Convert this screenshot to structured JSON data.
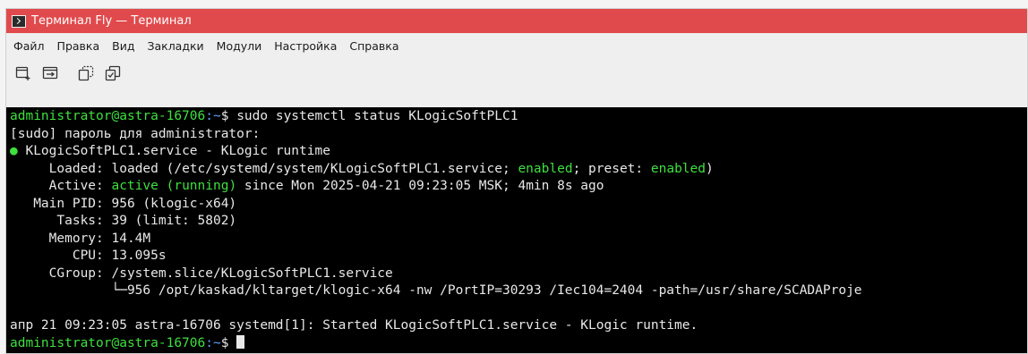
{
  "window": {
    "title": "Терминал Fly — Терминал"
  },
  "menu": [
    "Файл",
    "Правка",
    "Вид",
    "Закладки",
    "Модули",
    "Настройка",
    "Справка"
  ],
  "toolbar": {
    "icons": [
      "new-tab-icon",
      "new-window-icon",
      "copy-icon",
      "paste-icon"
    ]
  },
  "terminal": {
    "prompt_user": "administrator@astra-16706",
    "prompt_path": ":~",
    "prompt_suffix": "$ ",
    "command": "sudo systemctl status KLogicSoftPLC1",
    "sudo_line": "[sudo] пароль для administrator:",
    "unit_line": "KLogicSoftPLC1.service - KLogic runtime",
    "loaded_label": "     Loaded: ",
    "loaded_pre": "loaded (/etc/systemd/system/KLogicSoftPLC1.service; ",
    "loaded_enabled": "enabled",
    "loaded_mid": "; preset: ",
    "loaded_preset": "enabled",
    "loaded_post": ")",
    "active_label": "     Active: ",
    "active_state": "active (running)",
    "active_rest": " since Mon 2025-04-21 09:23:05 MSK; 4min 8s ago",
    "main_pid": "   Main PID: 956 (klogic-x64)",
    "tasks": "      Tasks: 39 (limit: 5802)",
    "memory": "     Memory: 14.4M",
    "cpu": "        CPU: 13.095s",
    "cgroup": "     CGroup: /system.slice/KLogicSoftPLC1.service",
    "cgroup_proc": "             └─956 /opt/kaskad/kltarget/klogic-x64 -nw /PortIP=30293 /Iec104=2404 -path=/usr/share/SCADAProje",
    "log_line": "апр 21 09:23:05 astra-16706 systemd[1]: Started KLogicSoftPLC1.service - KLogic runtime."
  },
  "colors": {
    "titlebar": "#e04a4c",
    "prompt_green": "#3ee03e",
    "path_blue": "#5fa0ff"
  }
}
